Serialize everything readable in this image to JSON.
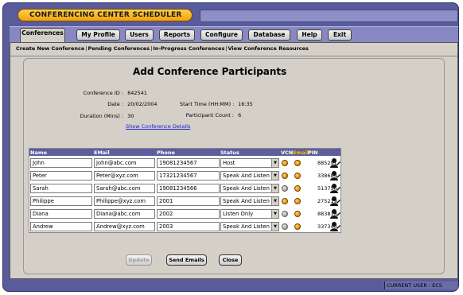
{
  "app": {
    "title": "CONFERENCING CENTER SCHEDULER"
  },
  "nav": {
    "tabs": [
      {
        "label": "Conferences",
        "active": true
      },
      {
        "label": "My Profile"
      },
      {
        "label": "Users"
      },
      {
        "label": "Reports"
      },
      {
        "label": "Configure"
      },
      {
        "label": "Database"
      },
      {
        "label": "Help"
      },
      {
        "label": "Exit"
      }
    ]
  },
  "subnav": {
    "items": [
      "Create New Conference",
      "Pending Conferences",
      "In-Progress Conferences",
      "View Conference Resources"
    ]
  },
  "page": {
    "heading": "Add Conference Participants",
    "conference_id_label": "Conference ID :",
    "conference_id": "842541",
    "date_label": "Date :",
    "date": "20/02/2004",
    "start_time_label": "Start Time (HH:MM) :",
    "start_time": "16:35",
    "duration_label": "Duration (Mins) :",
    "duration": "30",
    "participant_count_label": "Participant Count :",
    "participant_count": "6",
    "show_details_link": "Show Conference Details"
  },
  "table": {
    "headers": {
      "name": "Name",
      "email": "EMail",
      "phone": "Phone",
      "status": "Status",
      "vcn": "VCN",
      "email_col": "Email",
      "pin": "PIN"
    },
    "rows": [
      {
        "name": "John",
        "email": "John@abc.com",
        "phone": "19081234567",
        "status": "Host",
        "vcn": "orange",
        "email_sent": "orange",
        "pin": "885291"
      },
      {
        "name": "Peter",
        "email": "Peter@xyz.com",
        "phone": "17321234567",
        "status": "Speak And Listen",
        "vcn": "orange",
        "email_sent": "orange",
        "pin": "338684"
      },
      {
        "name": "Sarah",
        "email": "Sarah@abc.com",
        "phone": "19081234566",
        "status": "Speak And Listen",
        "vcn": "grey",
        "email_sent": "orange",
        "pin": "513756"
      },
      {
        "name": "Philippe",
        "email": "Philippe@xyz.com",
        "phone": "2001",
        "status": "Speak And Listen",
        "vcn": "orange",
        "email_sent": "orange",
        "pin": "275219"
      },
      {
        "name": "Diana",
        "email": "Diana@abc.com",
        "phone": "2002",
        "status": "Listen Only",
        "vcn": "grey",
        "email_sent": "orange",
        "pin": "883818"
      },
      {
        "name": "Andrew",
        "email": "Andrew@xyz.com",
        "phone": "2003",
        "status": "Speak And Listen",
        "vcn": "grey",
        "email_sent": "orange",
        "pin": "337340"
      }
    ]
  },
  "buttons": {
    "update": "Update",
    "send_emails": "Send Emails",
    "close": "Close"
  },
  "status_bar": {
    "text": "CURRENT USER : ECS"
  },
  "colors": {
    "frame": "#5a5b9a",
    "title_pill": "#f2a20a",
    "panel": "#d4d0c8",
    "table_header": "#5d5e9c",
    "link": "#1a1ad0"
  }
}
